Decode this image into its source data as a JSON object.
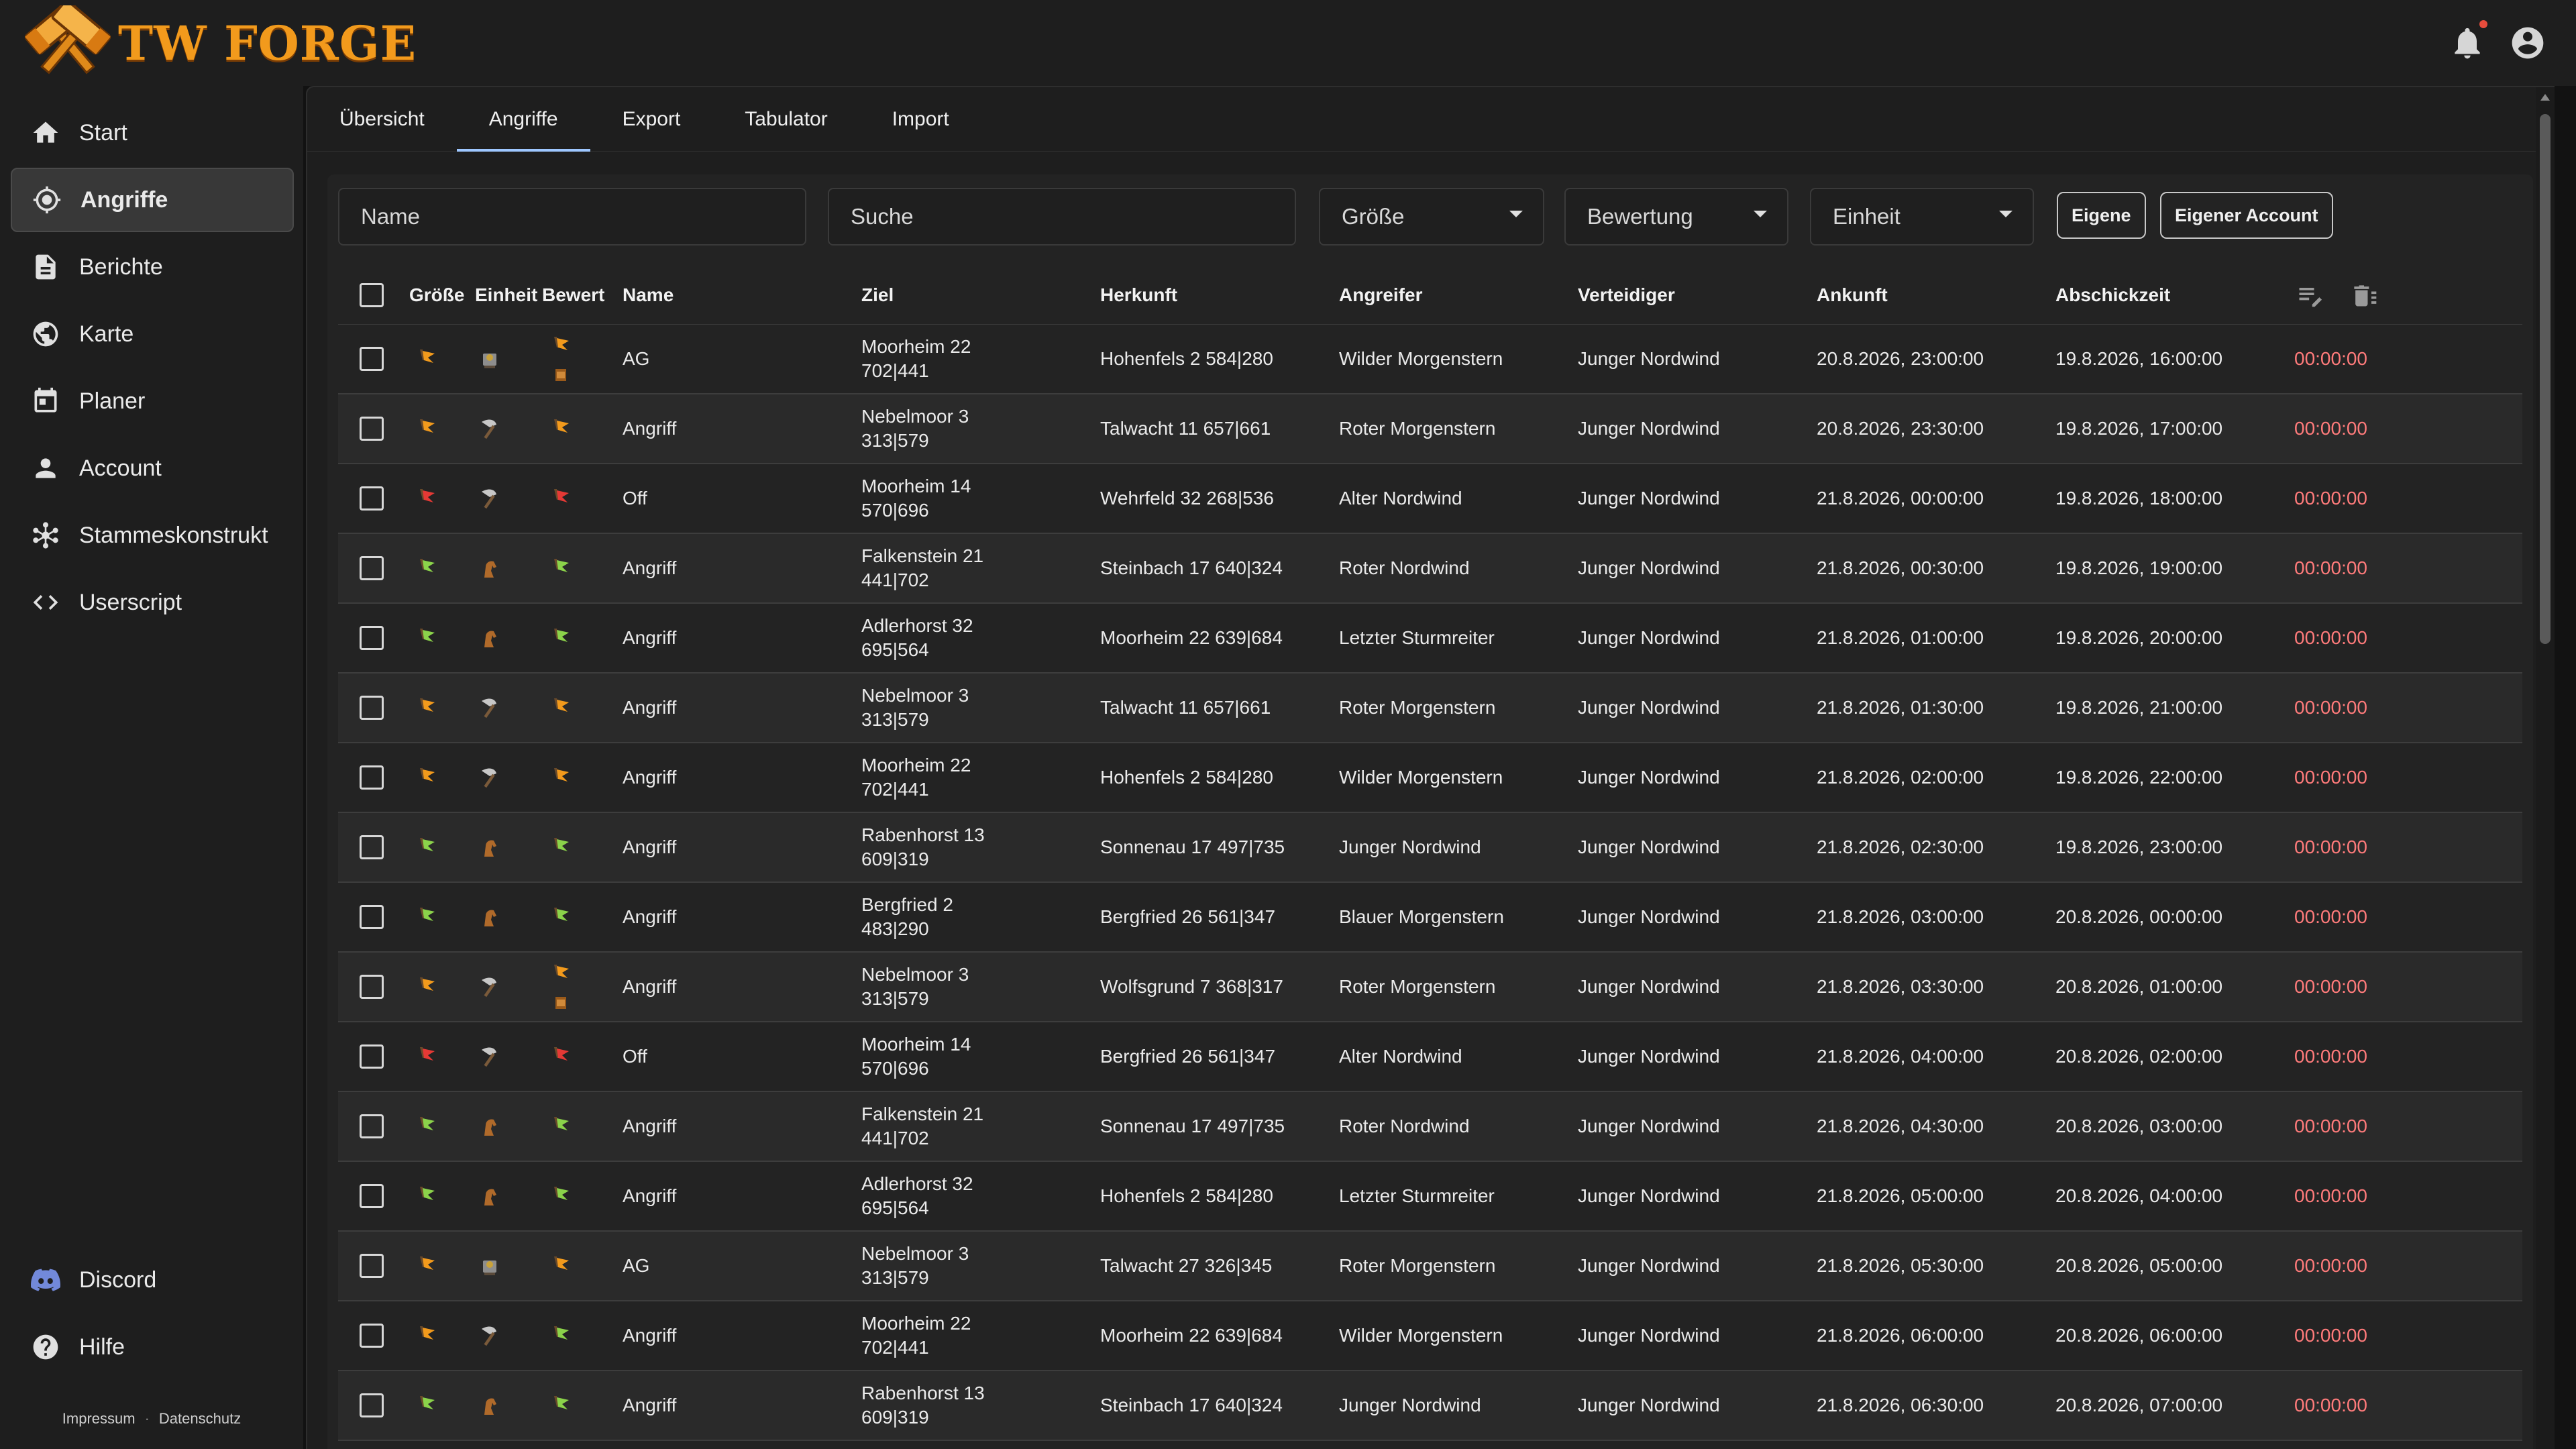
{
  "app": {
    "title": "TW FORGE"
  },
  "colors": {
    "accent": "#9ec7ff",
    "timer": "#ff7b7b",
    "brand": "#f29a1c",
    "active_nav": "#383838"
  },
  "sidebar": {
    "items": [
      {
        "label": "Start",
        "icon": "home-icon"
      },
      {
        "label": "Angriffe",
        "icon": "target-icon",
        "active": true
      },
      {
        "label": "Berichte",
        "icon": "report-icon"
      },
      {
        "label": "Karte",
        "icon": "globe-icon"
      },
      {
        "label": "Planer",
        "icon": "calendar-icon"
      },
      {
        "label": "Account",
        "icon": "person-icon"
      },
      {
        "label": "Stammeskonstrukt",
        "icon": "tribe-icon"
      },
      {
        "label": "Userscript",
        "icon": "code-icon"
      }
    ],
    "bottom_items": [
      {
        "label": "Discord",
        "icon": "discord-icon"
      },
      {
        "label": "Hilfe",
        "icon": "help-icon"
      }
    ],
    "footer": {
      "impressum": "Impressum",
      "sep": "·",
      "datenschutz": "Datenschutz"
    }
  },
  "tabs": [
    {
      "label": "Übersicht"
    },
    {
      "label": "Angriffe",
      "active": true
    },
    {
      "label": "Export"
    },
    {
      "label": "Tabulator"
    },
    {
      "label": "Import"
    }
  ],
  "filters": {
    "name_placeholder": "Name",
    "search_placeholder": "Suche",
    "size": "Größe",
    "rating": "Bewertung",
    "unit": "Einheit",
    "own_button": "Eigene",
    "own_account_button": "Eigener Account"
  },
  "table": {
    "headers": {
      "size": "Größe",
      "unit": "Einheit",
      "rating": "Bewert",
      "name": "Name",
      "target": "Ziel",
      "origin": "Herkunft",
      "attacker": "Angreifer",
      "defender": "Verteidiger",
      "arrival": "Ankunft",
      "send_time": "Abschickzeit"
    },
    "rows": [
      {
        "size": "orange",
        "unit": "ram",
        "rating": [
          "orange",
          "ram"
        ],
        "name": "AG",
        "target": "Moorheim 22 702|441",
        "origin": "Hohenfels 2 584|280",
        "attacker": "Wilder Morgenstern",
        "defender": "Junger Nordwind",
        "arrival": "20.8.2026, 23:00:00",
        "send": "19.8.2026, 16:00:00",
        "timer": "00:00:00"
      },
      {
        "size": "orange",
        "unit": "axe",
        "rating": [
          "orange"
        ],
        "name": "Angriff",
        "target": "Nebelmoor 3 313|579",
        "origin": "Talwacht 11 657|661",
        "attacker": "Roter Morgenstern",
        "defender": "Junger Nordwind",
        "arrival": "20.8.2026, 23:30:00",
        "send": "19.8.2026, 17:00:00",
        "timer": "00:00:00"
      },
      {
        "size": "red",
        "unit": "axe",
        "rating": [
          "red"
        ],
        "name": "Off",
        "target": "Moorheim 14 570|696",
        "origin": "Wehrfeld 32 268|536",
        "attacker": "Alter Nordwind",
        "defender": "Junger Nordwind",
        "arrival": "21.8.2026, 00:00:00",
        "send": "19.8.2026, 18:00:00",
        "timer": "00:00:00"
      },
      {
        "size": "green",
        "unit": "horse",
        "rating": [
          "green"
        ],
        "name": "Angriff",
        "target": "Falkenstein 21 441|702",
        "origin": "Steinbach 17 640|324",
        "attacker": "Roter Nordwind",
        "defender": "Junger Nordwind",
        "arrival": "21.8.2026, 00:30:00",
        "send": "19.8.2026, 19:00:00",
        "timer": "00:00:00"
      },
      {
        "size": "green",
        "unit": "horse",
        "rating": [
          "green"
        ],
        "name": "Angriff",
        "target": "Adlerhorst 32 695|564",
        "origin": "Moorheim 22 639|684",
        "attacker": "Letzter Sturmreiter",
        "defender": "Junger Nordwind",
        "arrival": "21.8.2026, 01:00:00",
        "send": "19.8.2026, 20:00:00",
        "timer": "00:00:00"
      },
      {
        "size": "orange",
        "unit": "axe",
        "rating": [
          "orange"
        ],
        "name": "Angriff",
        "target": "Nebelmoor 3 313|579",
        "origin": "Talwacht 11 657|661",
        "attacker": "Roter Morgenstern",
        "defender": "Junger Nordwind",
        "arrival": "21.8.2026, 01:30:00",
        "send": "19.8.2026, 21:00:00",
        "timer": "00:00:00"
      },
      {
        "size": "orange",
        "unit": "axe",
        "rating": [
          "orange"
        ],
        "name": "Angriff",
        "target": "Moorheim 22 702|441",
        "origin": "Hohenfels 2 584|280",
        "attacker": "Wilder Morgenstern",
        "defender": "Junger Nordwind",
        "arrival": "21.8.2026, 02:00:00",
        "send": "19.8.2026, 22:00:00",
        "timer": "00:00:00"
      },
      {
        "size": "green",
        "unit": "horse",
        "rating": [
          "green"
        ],
        "name": "Angriff",
        "target": "Rabenhorst 13 609|319",
        "origin": "Sonnenau 17 497|735",
        "attacker": "Junger Nordwind",
        "defender": "Junger Nordwind",
        "arrival": "21.8.2026, 02:30:00",
        "send": "19.8.2026, 23:00:00",
        "timer": "00:00:00"
      },
      {
        "size": "green",
        "unit": "horse",
        "rating": [
          "green"
        ],
        "name": "Angriff",
        "target": "Bergfried 2 483|290",
        "origin": "Bergfried 26 561|347",
        "attacker": "Blauer Morgenstern",
        "defender": "Junger Nordwind",
        "arrival": "21.8.2026, 03:00:00",
        "send": "20.8.2026, 00:00:00",
        "timer": "00:00:00"
      },
      {
        "size": "orange",
        "unit": "axe",
        "rating": [
          "orange",
          "ram"
        ],
        "name": "Angriff",
        "target": "Nebelmoor 3 313|579",
        "origin": "Wolfsgrund 7 368|317",
        "attacker": "Roter Morgenstern",
        "defender": "Junger Nordwind",
        "arrival": "21.8.2026, 03:30:00",
        "send": "20.8.2026, 01:00:00",
        "timer": "00:00:00"
      },
      {
        "size": "red",
        "unit": "axe",
        "rating": [
          "red"
        ],
        "name": "Off",
        "target": "Moorheim 14 570|696",
        "origin": "Bergfried 26 561|347",
        "attacker": "Alter Nordwind",
        "defender": "Junger Nordwind",
        "arrival": "21.8.2026, 04:00:00",
        "send": "20.8.2026, 02:00:00",
        "timer": "00:00:00"
      },
      {
        "size": "green",
        "unit": "horse",
        "rating": [
          "green"
        ],
        "name": "Angriff",
        "target": "Falkenstein 21 441|702",
        "origin": "Sonnenau 17 497|735",
        "attacker": "Roter Nordwind",
        "defender": "Junger Nordwind",
        "arrival": "21.8.2026, 04:30:00",
        "send": "20.8.2026, 03:00:00",
        "timer": "00:00:00"
      },
      {
        "size": "green",
        "unit": "horse",
        "rating": [
          "green"
        ],
        "name": "Angriff",
        "target": "Adlerhorst 32 695|564",
        "origin": "Hohenfels 2 584|280",
        "attacker": "Letzter Sturmreiter",
        "defender": "Junger Nordwind",
        "arrival": "21.8.2026, 05:00:00",
        "send": "20.8.2026, 04:00:00",
        "timer": "00:00:00"
      },
      {
        "size": "orange",
        "unit": "ram",
        "rating": [
          "orange"
        ],
        "name": "AG",
        "target": "Nebelmoor 3 313|579",
        "origin": "Talwacht 27 326|345",
        "attacker": "Roter Morgenstern",
        "defender": "Junger Nordwind",
        "arrival": "21.8.2026, 05:30:00",
        "send": "20.8.2026, 05:00:00",
        "timer": "00:00:00"
      },
      {
        "size": "orange",
        "unit": "axe",
        "rating": [
          "green"
        ],
        "name": "Angriff",
        "target": "Moorheim 22 702|441",
        "origin": "Moorheim 22 639|684",
        "attacker": "Wilder Morgenstern",
        "defender": "Junger Nordwind",
        "arrival": "21.8.2026, 06:00:00",
        "send": "20.8.2026, 06:00:00",
        "timer": "00:00:00"
      },
      {
        "size": "green",
        "unit": "horse",
        "rating": [
          "green"
        ],
        "name": "Angriff",
        "target": "Rabenhorst 13 609|319",
        "origin": "Steinbach 17 640|324",
        "attacker": "Junger Nordwind",
        "defender": "Junger Nordwind",
        "arrival": "21.8.2026, 06:30:00",
        "send": "20.8.2026, 07:00:00",
        "timer": "00:00:00"
      }
    ]
  }
}
